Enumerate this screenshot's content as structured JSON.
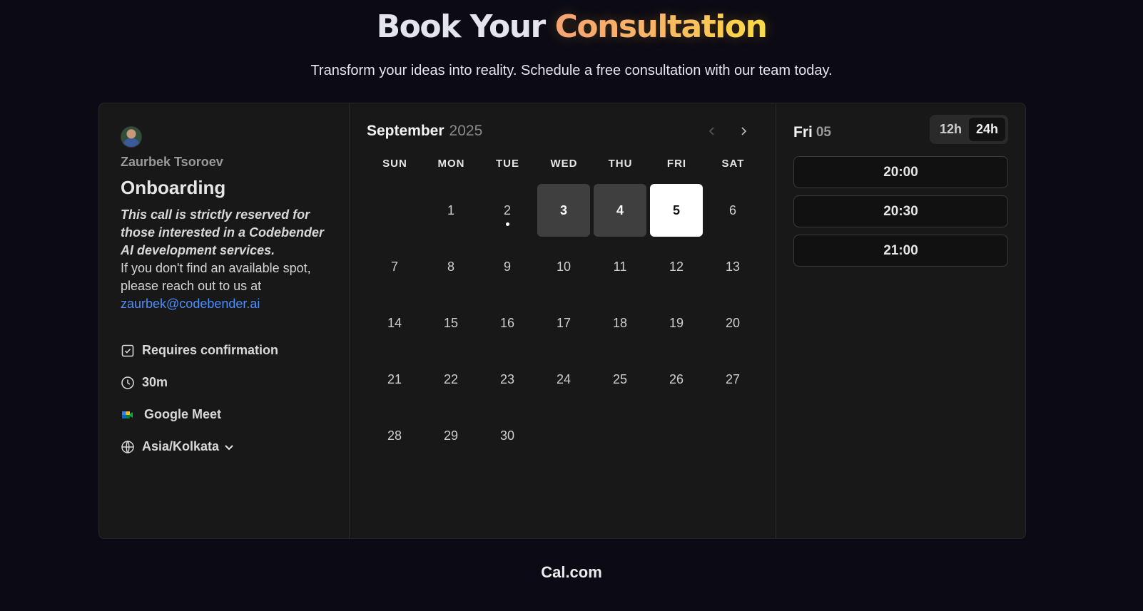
{
  "hero": {
    "title_part1": "Book Your ",
    "title_part2": "Consultation",
    "subtitle": "Transform your ideas into reality. Schedule a free consultation with our team today."
  },
  "event": {
    "host": "Zaurbek Tsoroev",
    "title": "Onboarding",
    "description_bold": "This call is strictly reserved for those interested in a Codebender AI development services.",
    "description": "If you don't find an available spot, please reach out to us at",
    "email": "zaurbek@codebender.ai",
    "meta": {
      "confirmation": "Requires confirmation",
      "duration": "30m",
      "location": "Google Meet",
      "timezone": "Asia/Kolkata"
    }
  },
  "calendar": {
    "month": "September",
    "year": "2025",
    "weekdays": [
      "SUN",
      "MON",
      "TUE",
      "WED",
      "THU",
      "FRI",
      "SAT"
    ],
    "leading_blanks": 1,
    "days": [
      {
        "n": "1",
        "state": "default"
      },
      {
        "n": "2",
        "state": "today"
      },
      {
        "n": "3",
        "state": "available"
      },
      {
        "n": "4",
        "state": "available"
      },
      {
        "n": "5",
        "state": "selected"
      },
      {
        "n": "6",
        "state": "default"
      },
      {
        "n": "7",
        "state": "default"
      },
      {
        "n": "8",
        "state": "default"
      },
      {
        "n": "9",
        "state": "default"
      },
      {
        "n": "10",
        "state": "default"
      },
      {
        "n": "11",
        "state": "default"
      },
      {
        "n": "12",
        "state": "default"
      },
      {
        "n": "13",
        "state": "default"
      },
      {
        "n": "14",
        "state": "default"
      },
      {
        "n": "15",
        "state": "default"
      },
      {
        "n": "16",
        "state": "default"
      },
      {
        "n": "17",
        "state": "default"
      },
      {
        "n": "18",
        "state": "default"
      },
      {
        "n": "19",
        "state": "default"
      },
      {
        "n": "20",
        "state": "default"
      },
      {
        "n": "21",
        "state": "default"
      },
      {
        "n": "22",
        "state": "default"
      },
      {
        "n": "23",
        "state": "default"
      },
      {
        "n": "24",
        "state": "default"
      },
      {
        "n": "25",
        "state": "default"
      },
      {
        "n": "26",
        "state": "default"
      },
      {
        "n": "27",
        "state": "default"
      },
      {
        "n": "28",
        "state": "default"
      },
      {
        "n": "29",
        "state": "default"
      },
      {
        "n": "30",
        "state": "default"
      }
    ]
  },
  "slots": {
    "day_label": "Fri",
    "date_label": "05",
    "format_options": [
      "12h",
      "24h"
    ],
    "format_selected": "24h",
    "times": [
      "20:00",
      "20:30",
      "21:00"
    ]
  },
  "footer": {
    "brand": "Cal.com"
  },
  "colors": {
    "background": "#0c0a15",
    "card": "#181818",
    "link": "#4f8ef7",
    "gradient_start": "#f7a27a",
    "gradient_end": "#fde047"
  }
}
